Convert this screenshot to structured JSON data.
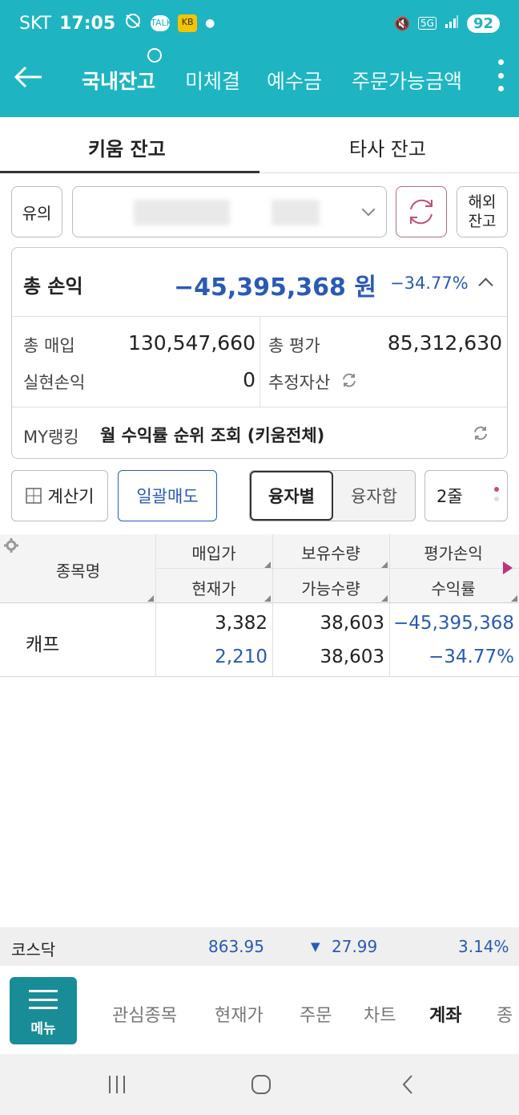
{
  "status": {
    "carrier": "SKT",
    "time": "17:05",
    "talk": "TALK",
    "kb": "KB",
    "net": "5G",
    "battery": "92"
  },
  "header": {
    "tabs": [
      {
        "label": "국내잔고",
        "active": true
      },
      {
        "label": "미체결"
      },
      {
        "label": "예수금"
      },
      {
        "label": "주문가능금액"
      }
    ]
  },
  "subtabs": [
    {
      "label": "키움 잔고",
      "active": true
    },
    {
      "label": "타사 잔고"
    }
  ],
  "account": {
    "caution": "유의",
    "overseas_line1": "해외",
    "overseas_line2": "잔고"
  },
  "summary": {
    "total_pl_label": "총 손익",
    "total_pl_value": "−45,395,368",
    "total_pl_unit": "원",
    "total_pl_pct": "−34.77%",
    "purchase_label": "총 매입",
    "purchase_value": "130,547,660",
    "eval_label": "총 평가",
    "eval_value": "85,312,630",
    "realized_label": "실현손익",
    "realized_value": "0",
    "est_asset_label": "추정자산",
    "ranking_label": "MY랭킹",
    "ranking_text": "월 수익률 순위 조회 (키움전체)"
  },
  "controls": {
    "calculator": "계산기",
    "bulk_sell": "일괄매도",
    "seg_on": "융자별",
    "seg_off": "융자합",
    "lines": "2줄"
  },
  "table": {
    "headers": {
      "name": "종목명",
      "buy_price": "매입가",
      "cur_price": "현재가",
      "holding_qty": "보유수량",
      "avail_qty": "가능수량",
      "eval_pl": "평가손익",
      "return_rate": "수익률"
    },
    "rows": [
      {
        "name": "캐프",
        "buy_price": "3,382",
        "cur_price": "2,210",
        "holding_qty": "38,603",
        "avail_qty": "38,603",
        "eval_pl": "−45,395,368",
        "return_rate": "−34.77%"
      }
    ]
  },
  "index": {
    "name": "코스닥",
    "value": "863.95",
    "change": "27.99",
    "pct": "3.14%"
  },
  "bottom_nav": {
    "menu": "메뉴",
    "items": [
      "관심종목",
      "현재가",
      "주문",
      "차트",
      "계좌",
      "종"
    ],
    "active": "계좌"
  },
  "colors": {
    "header": "#1fb4c1",
    "negative": "#2a5ab4",
    "menu": "#188d98"
  }
}
